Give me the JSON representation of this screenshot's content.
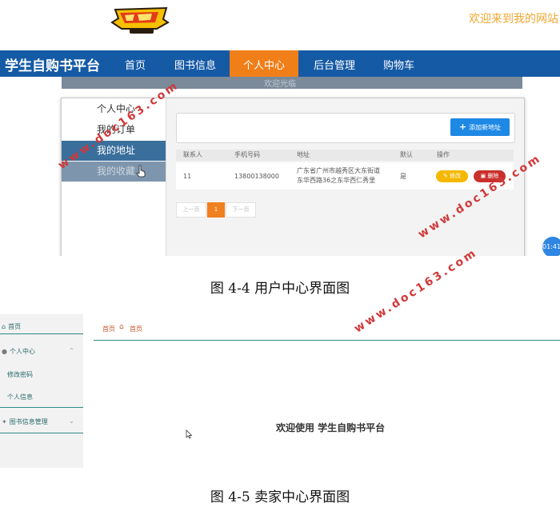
{
  "colors": {
    "nav": "#155aa5",
    "nav_active": "#f07f19",
    "welcome": "#f0a630",
    "sidebar_text": "#2b6a6a",
    "watermark": "#d13838"
  },
  "fig1": {
    "welcome": "欢迎来到我的网站",
    "brand": "学生自购书平台",
    "nav": [
      "首页",
      "图书信息",
      "个人中心",
      "后台管理",
      "购物车"
    ],
    "active_nav": "个人中心",
    "hero_text": "欢迎光临",
    "left_menu": [
      "个人中心",
      "我的订单",
      "我的地址",
      "我的收藏"
    ],
    "add_button": "添加新地址",
    "table": {
      "headers": [
        "联系人",
        "手机号码",
        "地址",
        "默认",
        "操作"
      ],
      "row": {
        "contact": "11",
        "phone": "13800138000",
        "address_line1": "广东省广州市越秀区大东街道",
        "address_line2": "东华西路36之东华西仁秀里",
        "default": "是",
        "edit": "修改",
        "delete": "删除"
      }
    },
    "pager": [
      "上一页",
      "1",
      "下一页"
    ],
    "float_time": "01:41"
  },
  "caption1": "图 4-4 用户中心界面图",
  "fig2": {
    "sidebar": [
      "首页",
      "个人中心",
      "修改密码",
      "个人信息",
      "图书信息管理"
    ],
    "breadcrumb": [
      "首页",
      "首页"
    ],
    "welcome": "欢迎使用 学生自购书平台"
  },
  "caption2": "图 4-5 卖家中心界面图",
  "watermarks": [
    "www.doc163.com",
    "www.doc163.com",
    "www.doc163.com"
  ],
  "icons": [
    "logo-emblem",
    "plus-icon",
    "pencil-icon",
    "trash-icon",
    "home-icon",
    "user-icon",
    "chevron-up-icon",
    "chevron-down-icon",
    "settings-icon",
    "cursor-icon"
  ]
}
